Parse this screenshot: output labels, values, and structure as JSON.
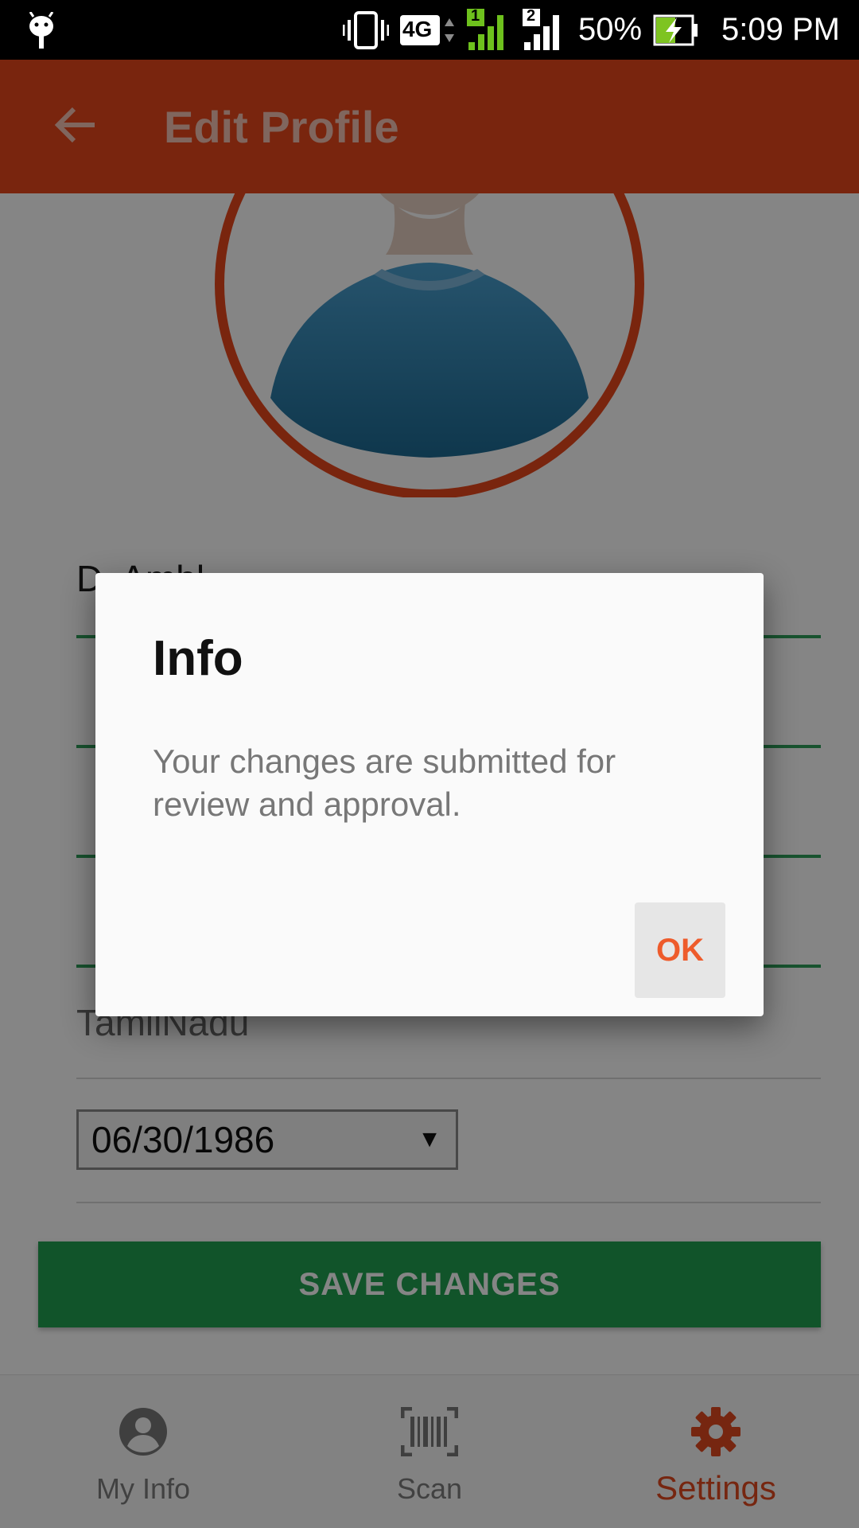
{
  "status_bar": {
    "network": "4G",
    "sim1": "1",
    "sim2": "2",
    "battery": "50%",
    "time": "5:09 PM",
    "icons": [
      "android-debug-icon",
      "vibrate-icon",
      "lte-icon",
      "signal-sim1-icon",
      "signal-sim2-icon",
      "battery-charging-icon"
    ]
  },
  "app_bar": {
    "title": "Edit Profile",
    "back_icon": "arrow-left-icon",
    "color": "#e8471c"
  },
  "form": {
    "partial_name": "D. Ambl",
    "state": "TamilNadu",
    "dob": "06/30/1986",
    "line_color": "#2fa05a"
  },
  "save_button": {
    "label": "SAVE CHANGES",
    "color": "#21a152"
  },
  "bottom_nav": {
    "items": [
      {
        "label": "My Info",
        "icon": "account-circle-icon",
        "active": false
      },
      {
        "label": "Scan",
        "icon": "barcode-icon",
        "active": false
      },
      {
        "label": "Settings",
        "icon": "gear-icon",
        "active": true
      }
    ],
    "active_color": "#e24a1f"
  },
  "dialog": {
    "title": "Info",
    "message": "Your changes are submitted for review and approval.",
    "ok_label": "OK",
    "ok_color": "#ee5b2b"
  }
}
